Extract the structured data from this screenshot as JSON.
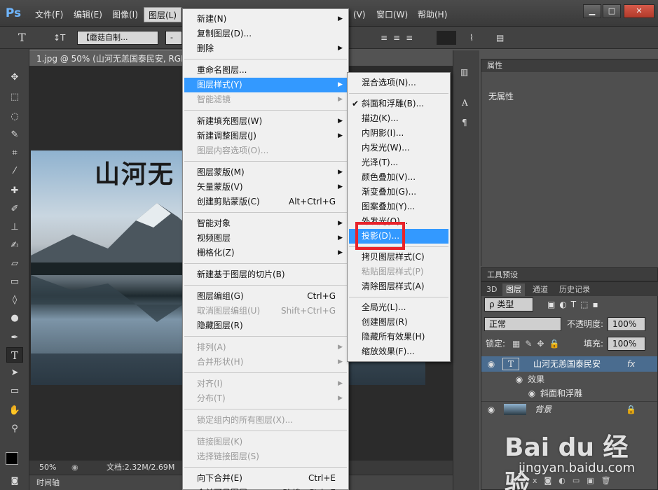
{
  "app": {
    "logo": "Ps"
  },
  "menubar": {
    "items": [
      "文件(F)",
      "编辑(E)",
      "图像(I)",
      "图层(L)",
      "(V)",
      "窗口(W)",
      "帮助(H)"
    ],
    "active_index": 3,
    "win_min": "▁",
    "win_max": "□",
    "win_close": "✕"
  },
  "options": {
    "font_name": "【蘑菇自制...",
    "font_style": "-",
    "text_type_icon": "T",
    "orient_icon": "↕T"
  },
  "document": {
    "tab_title": "1.jpg @ 50% (山河无恙国泰民安, RGB",
    "logo_text": "山河无",
    "zoom": "50%",
    "doc_size": "文档:2.32M/2.69M",
    "timeline": "时间轴"
  },
  "properties": {
    "tab": "属性",
    "none_text": "无属性"
  },
  "presets": {
    "tab": "工具预设"
  },
  "layers": {
    "tabs": [
      "3D",
      "图层",
      "通道",
      "历史记录"
    ],
    "active_tab": 1,
    "filter_label": "ρ 类型",
    "blend_mode": "正常",
    "opacity_label": "不透明度:",
    "opacity_value": "100%",
    "lock_label": "锁定:",
    "fill_label": "填充:",
    "fill_value": "100%",
    "items": [
      {
        "name": "山河无恙国泰民安",
        "fx": "fx",
        "thumb": "T"
      },
      {
        "name": "效果"
      },
      {
        "name": "斜面和浮雕"
      },
      {
        "name": "背景"
      }
    ]
  },
  "layer_menu": {
    "items": [
      {
        "label": "新建(N)",
        "arrow": true
      },
      {
        "label": "复制图层(D)..."
      },
      {
        "label": "删除",
        "arrow": true
      },
      {
        "sep": true
      },
      {
        "label": "重命名图层..."
      },
      {
        "label": "图层样式(Y)",
        "arrow": true,
        "highlight": true
      },
      {
        "label": "智能滤镜",
        "arrow": true,
        "disabled": true
      },
      {
        "sep": true
      },
      {
        "label": "新建填充图层(W)",
        "arrow": true
      },
      {
        "label": "新建调整图层(J)",
        "arrow": true
      },
      {
        "label": "图层内容选项(O)...",
        "disabled": true
      },
      {
        "sep": true
      },
      {
        "label": "图层蒙版(M)",
        "arrow": true
      },
      {
        "label": "矢量蒙版(V)",
        "arrow": true
      },
      {
        "label": "创建剪贴蒙版(C)",
        "shortcut": "Alt+Ctrl+G"
      },
      {
        "sep": true
      },
      {
        "label": "智能对象",
        "arrow": true
      },
      {
        "label": "视频图层",
        "arrow": true
      },
      {
        "label": "栅格化(Z)",
        "arrow": true
      },
      {
        "sep": true
      },
      {
        "label": "新建基于图层的切片(B)"
      },
      {
        "sep": true
      },
      {
        "label": "图层编组(G)",
        "shortcut": "Ctrl+G"
      },
      {
        "label": "取消图层编组(U)",
        "shortcut": "Shift+Ctrl+G",
        "disabled": true
      },
      {
        "label": "隐藏图层(R)"
      },
      {
        "sep": true
      },
      {
        "label": "排列(A)",
        "arrow": true,
        "disabled": true
      },
      {
        "label": "合并形状(H)",
        "arrow": true,
        "disabled": true
      },
      {
        "sep": true
      },
      {
        "label": "对齐(I)",
        "arrow": true,
        "disabled": true
      },
      {
        "label": "分布(T)",
        "arrow": true,
        "disabled": true
      },
      {
        "sep": true
      },
      {
        "label": "锁定组内的所有图层(X)...",
        "disabled": true
      },
      {
        "sep": true
      },
      {
        "label": "链接图层(K)",
        "disabled": true
      },
      {
        "label": "选择链接图层(S)",
        "disabled": true
      },
      {
        "sep": true
      },
      {
        "label": "向下合并(E)",
        "shortcut": "Ctrl+E"
      },
      {
        "label": "合并可见图层",
        "shortcut": "Shift+Ctrl+E"
      }
    ]
  },
  "style_menu": {
    "items": [
      {
        "label": "混合选项(N)..."
      },
      {
        "sep": true
      },
      {
        "label": "斜面和浮雕(B)...",
        "checked": true
      },
      {
        "label": "描边(K)..."
      },
      {
        "label": "内阴影(I)..."
      },
      {
        "label": "内发光(W)..."
      },
      {
        "label": "光泽(T)..."
      },
      {
        "label": "颜色叠加(V)..."
      },
      {
        "label": "渐变叠加(G)..."
      },
      {
        "label": "图案叠加(Y)..."
      },
      {
        "label": "外发光(O)..."
      },
      {
        "label": "投影(D)...",
        "highlight": true
      },
      {
        "sep": true
      },
      {
        "label": "拷贝图层样式(C)"
      },
      {
        "label": "粘贴图层样式(P)",
        "disabled": true
      },
      {
        "label": "清除图层样式(A)"
      },
      {
        "sep": true
      },
      {
        "label": "全局光(L)..."
      },
      {
        "label": "创建图层(R)"
      },
      {
        "label": "隐藏所有效果(H)"
      },
      {
        "label": "缩放效果(F)..."
      }
    ]
  },
  "watermark": {
    "main": "Bai du 经验",
    "sub": "jingyan.baidu.com"
  }
}
